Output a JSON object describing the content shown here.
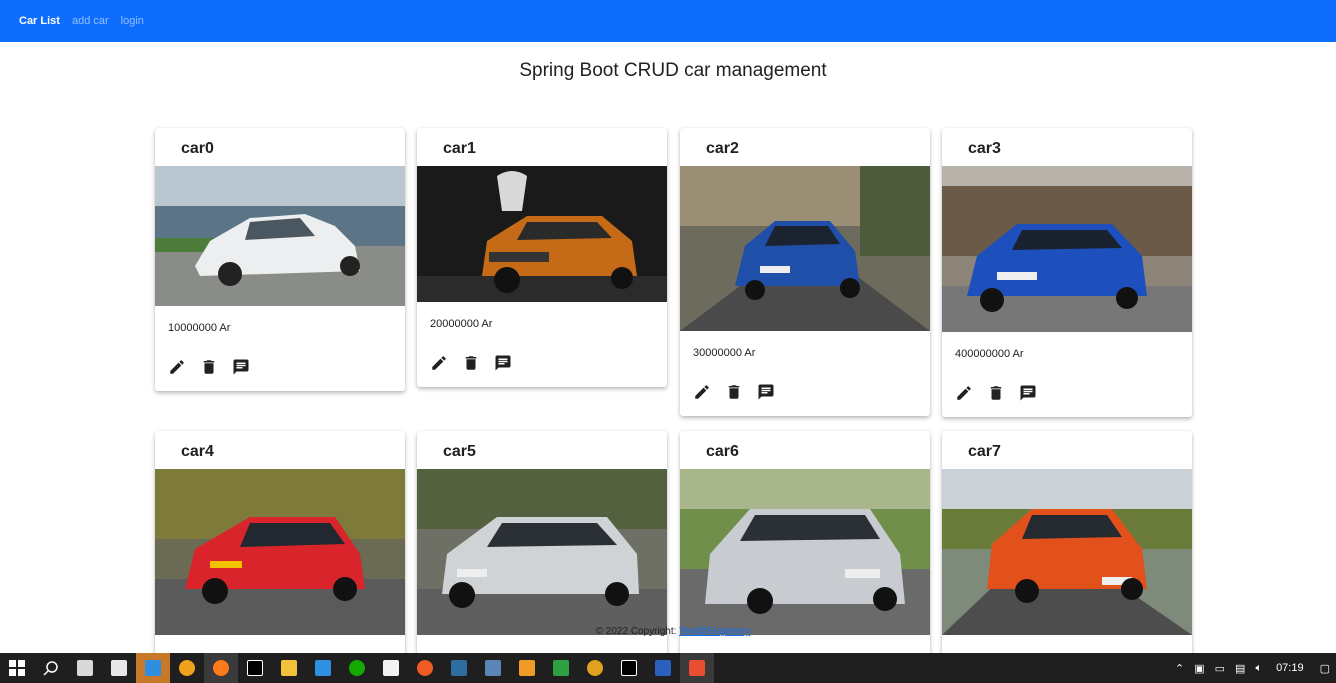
{
  "nav": {
    "brand": "Car List",
    "links": [
      "add car",
      "login"
    ]
  },
  "page_title": "Spring Boot CRUD car management",
  "cars": [
    {
      "name": "car0",
      "price": "10000000 Ar",
      "image": "white hatchback by the sea"
    },
    {
      "name": "car1",
      "price": "20000000 Ar",
      "image": "orange SUV at night"
    },
    {
      "name": "car2",
      "price": "30000000 Ar",
      "image": "blue hatchback on road"
    },
    {
      "name": "car3",
      "price": "400000000 Ar",
      "image": "blue SUV on road"
    },
    {
      "name": "car4",
      "price": "",
      "image": "red hatchback"
    },
    {
      "name": "car5",
      "price": "",
      "image": "silver crossover"
    },
    {
      "name": "car6",
      "price": "",
      "image": "silver crossover"
    },
    {
      "name": "car7",
      "price": "",
      "image": "orange hatchback"
    }
  ],
  "footer": {
    "text": "© 2022 Copyright:",
    "link": "Test@Engenery"
  },
  "taskbar": {
    "time": "07:19",
    "icons": [
      "windows-start-icon",
      "search-icon",
      "task-view-icon",
      "store-icon",
      "mail-icon",
      "search-app-icon",
      "firefox-icon",
      "intellij-icon",
      "file-explorer-icon",
      "vscode-icon",
      "upwork-icon",
      "file-icon",
      "postman-icon",
      "mysql-workbench-icon",
      "postgres-icon",
      "app-icon",
      "app-icon",
      "chrome-icon",
      "intellij-icon",
      "word-icon",
      "git-icon"
    ]
  },
  "colors": {
    "navbar": "#0d6efd",
    "taskbar": "#1f1f1f"
  }
}
